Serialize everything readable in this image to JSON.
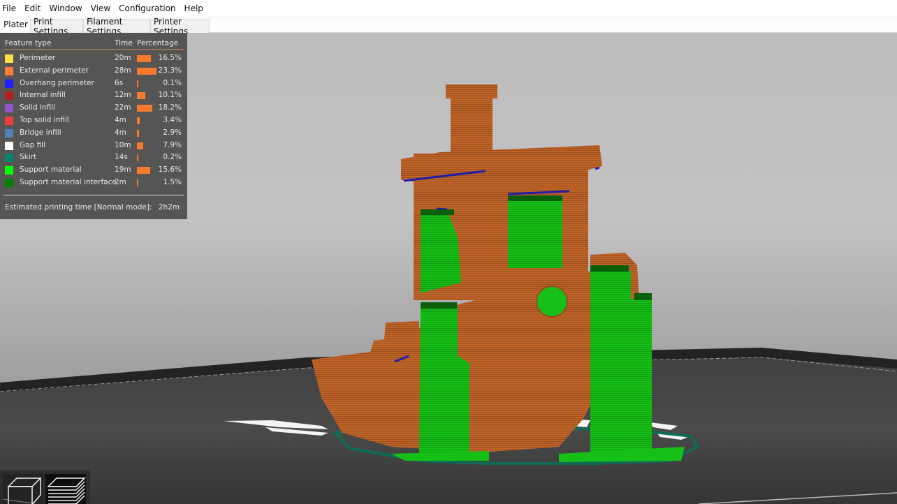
{
  "menubar": {
    "items": [
      "File",
      "Edit",
      "Window",
      "View",
      "Configuration",
      "Help"
    ]
  },
  "tabs": [
    {
      "label": "Plater",
      "active": true
    },
    {
      "label": "Print Settings",
      "active": false
    },
    {
      "label": "Filament Settings",
      "active": false
    },
    {
      "label": "Printer Settings",
      "active": false
    }
  ],
  "legend": {
    "headers": {
      "feature": "Feature type",
      "time": "Time",
      "percentage": "Percentage"
    },
    "bar_color": "#f37a2e",
    "rows": [
      {
        "label": "Perimeter",
        "color": "#ffe040",
        "time": "20m",
        "percent": 16.5,
        "percent_label": "16.5%"
      },
      {
        "label": "External perimeter",
        "color": "#ff7d38",
        "time": "28m",
        "percent": 23.3,
        "percent_label": "23.3%"
      },
      {
        "label": "Overhang perimeter",
        "color": "#1f1fff",
        "time": "6s",
        "percent": 0.1,
        "percent_label": "0.1%"
      },
      {
        "label": "Internal infill",
        "color": "#b01e1e",
        "time": "12m",
        "percent": 10.1,
        "percent_label": "10.1%"
      },
      {
        "label": "Solid infill",
        "color": "#9654cc",
        "time": "22m",
        "percent": 18.2,
        "percent_label": "18.2%"
      },
      {
        "label": "Top solid infill",
        "color": "#f03c3c",
        "time": "4m",
        "percent": 3.4,
        "percent_label": "3.4%"
      },
      {
        "label": "Bridge infill",
        "color": "#4d80ba",
        "time": "4m",
        "percent": 2.9,
        "percent_label": "2.9%"
      },
      {
        "label": "Gap fill",
        "color": "#ffffff",
        "time": "10m",
        "percent": 7.9,
        "percent_label": "7.9%"
      },
      {
        "label": "Skirt",
        "color": "#00876e",
        "time": "14s",
        "percent": 0.2,
        "percent_label": "0.2%"
      },
      {
        "label": "Support material",
        "color": "#00ff00",
        "time": "19m",
        "percent": 15.6,
        "percent_label": "15.6%"
      },
      {
        "label": "Support material interface",
        "color": "#008000",
        "time": "2m",
        "percent": 1.5,
        "percent_label": "1.5%"
      }
    ],
    "estimate_label": "Estimated printing time [Normal mode]:",
    "estimate_value": "2h2m"
  },
  "view_toolbar": {
    "buttons": [
      {
        "name": "3d-view",
        "icon": "cube-icon"
      },
      {
        "name": "preview",
        "icon": "layers-icon"
      }
    ]
  },
  "scene": {
    "model_color": "#c0652a",
    "support_color": "#14b814",
    "support_interface_color": "#0b5e0b",
    "overhang_color": "#1e1ea8",
    "skirt_color": "#0f6b57",
    "bed_color": "#3f3f3f"
  }
}
